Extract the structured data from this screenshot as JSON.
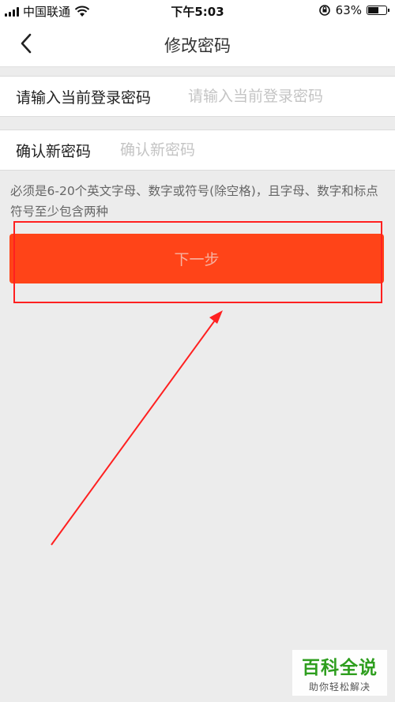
{
  "status_bar": {
    "carrier": "中国联通",
    "time": "下午5:03",
    "battery_percent": "63%",
    "battery_level": 0.63
  },
  "nav": {
    "title": "修改密码",
    "back_icon": "chevron-left-icon"
  },
  "form": {
    "current_password": {
      "label": "请输入当前登录密码",
      "placeholder": "请输入当前登录密码",
      "value": ""
    },
    "new_password": {
      "label": "确认新密码",
      "placeholder": "确认新密码",
      "value": ""
    },
    "hint": "必须是6-20个英文字母、数字或符号(除空格)，且字母、数字和标点符号至少包含两种"
  },
  "actions": {
    "next_label": "下一步"
  },
  "annotation": {
    "color": "#ff2020"
  },
  "watermark": {
    "title": "百科全说",
    "subtitle": "助你轻松解决"
  },
  "colors": {
    "accent": "#ff4418",
    "background": "#ececec",
    "watermark_green": "#2e9e1e"
  }
}
